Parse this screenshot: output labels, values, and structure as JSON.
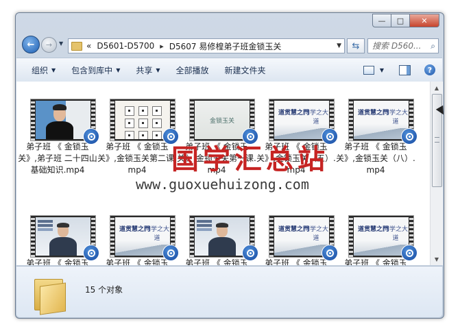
{
  "window": {
    "caption_buttons": {
      "minimize": "—",
      "maximize": "□",
      "close": "✕"
    }
  },
  "address_bar": {
    "overflow": "«",
    "segments": [
      "D5601-D5700",
      "D5607 易修楻弟子班金锁玉关"
    ],
    "separator": "▸"
  },
  "search": {
    "placeholder": "搜索 D560..."
  },
  "toolbar": {
    "items": [
      {
        "label": "组织",
        "has_dropdown": true
      },
      {
        "label": "包含到库中",
        "has_dropdown": true
      },
      {
        "label": "共享",
        "has_dropdown": true
      },
      {
        "label": "全部播放",
        "has_dropdown": false
      },
      {
        "label": "新建文件夹",
        "has_dropdown": false
      }
    ],
    "dropdown_glyph": "▼"
  },
  "files": [
    {
      "name": "弟子班 《 金锁玉关》,弟子班 二十四山 基础知识.mp4",
      "thumb": "person"
    },
    {
      "name": "弟子班 《 金锁玉关》,金锁玉关第二课.mp4",
      "thumb": "chart"
    },
    {
      "name": "弟子班 《 金锁玉关》,金锁玉关第一课.mp4",
      "thumb": "title",
      "thumb_text": "金锁玉关"
    },
    {
      "name": "弟子班 《 金锁玉关》,金锁玉关（五）.mp4",
      "thumb": "calli"
    },
    {
      "name": "弟子班 《 金锁玉关》,金锁玉关（八）.mp4",
      "thumb": "calli"
    },
    {
      "name": "弟子班 《 金锁玉关》,金锁玉关（",
      "thumb": "person2"
    },
    {
      "name": "弟子班 《 金锁玉关》,金锁玉关（",
      "thumb": "calli"
    },
    {
      "name": "弟子班 《 金锁玉关》,金锁玉关（",
      "thumb": "person2"
    },
    {
      "name": "弟子班 《 金锁玉关》,金锁玉关（",
      "thumb": "calli"
    },
    {
      "name": "弟子班 《 金锁玉关》,金锁玉关（",
      "thumb": "calli"
    }
  ],
  "calligraphy_text": [
    "道贯慧之門",
    "问学之大道"
  ],
  "status": {
    "item_count": "15 个对象"
  },
  "watermark": {
    "title": "国学汇总站",
    "url": "www.guoxuehuizong.com"
  },
  "colors": {
    "accent": "#1d5fb3",
    "watermark_red": "#c62423",
    "toolbar_text": "#1c3050"
  }
}
